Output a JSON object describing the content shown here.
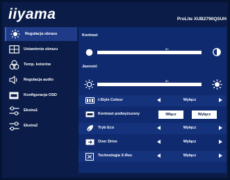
{
  "brand": "iiyama",
  "model": "ProLite XUB2790QSUH",
  "sidebar": {
    "items": [
      {
        "label": "Regulacja obrazu",
        "icon": "brightness-sun-icon"
      },
      {
        "label": "Ustawienia obrazu",
        "icon": "display-settings-icon"
      },
      {
        "label": "Temp. kolorów",
        "icon": "color-temperature-icon"
      },
      {
        "label": "Regulacja audio",
        "icon": "speaker-icon"
      },
      {
        "label": "Konfiguracja OSD",
        "icon": "osd-icon"
      },
      {
        "label": "Ekstra1",
        "icon": "sliders-icon"
      },
      {
        "label": "Ekstra2",
        "icon": "sliders-icon"
      }
    ]
  },
  "main": {
    "contrast": {
      "label": "Kontrast",
      "value": 80,
      "max": 100
    },
    "brightness": {
      "label": "Jasność",
      "value": 80,
      "max": 100
    },
    "options": [
      {
        "label": "i-Style Colour",
        "value": "Wyłącz",
        "icon": "istyle-icon"
      },
      {
        "label": "Kontrast podwyższony",
        "value_left": "Włącz",
        "value_right": "Wyłącz",
        "icon": "acr-icon"
      },
      {
        "label": "Tryb Eco",
        "value": "Wyłącz",
        "icon": "eco-icon"
      },
      {
        "label": "Over Drive",
        "value": "Wyłącz",
        "icon": "overdrive-icon"
      },
      {
        "label": "Technologia X-Res",
        "value": "Wyłącz",
        "icon": "xres-icon"
      }
    ]
  }
}
